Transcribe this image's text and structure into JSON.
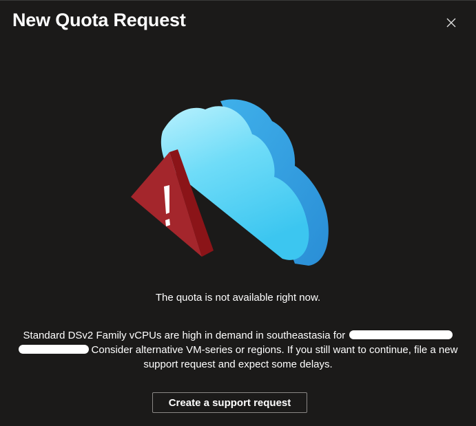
{
  "dialog": {
    "title": "New Quota Request",
    "close_icon": "close-icon"
  },
  "illustration": {
    "icons": [
      "cloud-icon",
      "warning-triangle-icon"
    ],
    "colors": {
      "cloud_light": "#8ee6fb",
      "cloud_mid": "#50d0f4",
      "cloud_side": "#2f9fe0",
      "triangle_front": "#a4262c",
      "triangle_side": "#7a1418"
    }
  },
  "status_text": "The quota is not available right now.",
  "message": {
    "part1": "Standard DSv2 Family vCPUs are high in demand in southeastasia for",
    "part2": "Consider alternative VM-series or regions. If you still want to continue, file a new support request and expect some delays."
  },
  "actions": {
    "support_label": "Create a support request"
  }
}
